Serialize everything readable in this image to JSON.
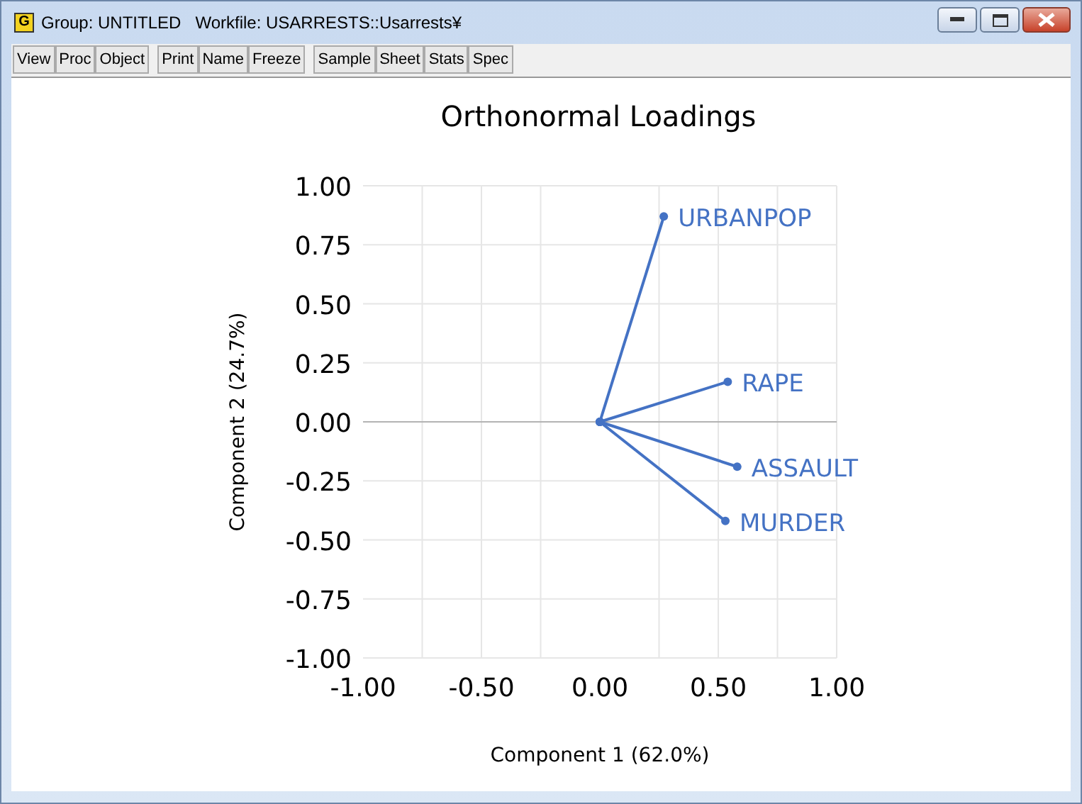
{
  "window": {
    "title_parts": [
      "Group: UNTITLED",
      "Workfile: USARRESTS::Usarrests¥"
    ],
    "app_icon": "G"
  },
  "toolbar": [
    [
      "View",
      "Proc",
      "Object"
    ],
    [
      "Print",
      "Name",
      "Freeze"
    ],
    [
      "Sample",
      "Sheet",
      "Stats",
      "Spec"
    ]
  ],
  "chart_data": {
    "type": "line",
    "grid": true,
    "title": "Orthonormal Loadings",
    "xlabel": "Component 1 (62.0%)",
    "ylabel": "Component 2 (24.7%)",
    "xlim": [
      -1,
      1
    ],
    "ylim": [
      -1,
      1
    ],
    "xticks": [
      {
        "value": -1,
        "label": "-1.00"
      },
      {
        "value": -0.5,
        "label": "-0.50"
      },
      {
        "value": 0,
        "label": "0.00"
      },
      {
        "value": 0.5,
        "label": "0.50"
      },
      {
        "value": 1,
        "label": "1.00"
      }
    ],
    "yticks": [
      {
        "value": 1,
        "label": "1.00"
      },
      {
        "value": 0.75,
        "label": "0.75"
      },
      {
        "value": 0.5,
        "label": "0.50"
      },
      {
        "value": 0.25,
        "label": "0.25"
      },
      {
        "value": 0,
        "label": "0.00"
      },
      {
        "value": -0.25,
        "label": "-0.25"
      },
      {
        "value": -0.5,
        "label": "-0.50"
      },
      {
        "value": -0.75,
        "label": "-0.75"
      },
      {
        "value": -1,
        "label": "-1.00"
      }
    ],
    "series": [
      {
        "name": "URBANPOP",
        "color": "#4472c4",
        "marker": "circle",
        "x": [
          0,
          0.27
        ],
        "values": [
          0,
          0.87
        ]
      },
      {
        "name": "RAPE",
        "color": "#4472c4",
        "marker": "circle",
        "x": [
          0,
          0.54
        ],
        "values": [
          0,
          0.17
        ]
      },
      {
        "name": "ASSAULT",
        "color": "#4472c4",
        "marker": "circle",
        "x": [
          0,
          0.58
        ],
        "values": [
          0,
          -0.19
        ]
      },
      {
        "name": "MURDER",
        "color": "#4472c4",
        "marker": "circle",
        "x": [
          0,
          0.53
        ],
        "values": [
          0,
          -0.42
        ]
      }
    ]
  }
}
